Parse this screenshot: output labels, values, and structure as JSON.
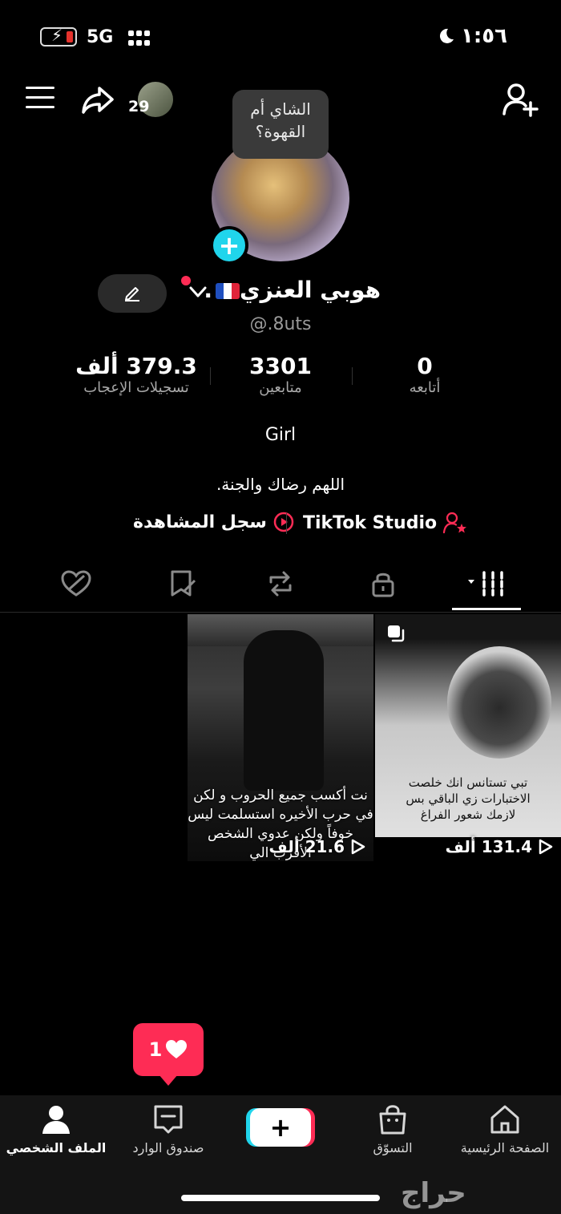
{
  "status": {
    "time": "١:٥٦",
    "network": "5G"
  },
  "header": {
    "friend_count": "29"
  },
  "profile": {
    "bubble_text": "الشاي أم القهوة؟",
    "display_name": "هوبي العنزي",
    "name_suffix": ".",
    "username": "@.8uts",
    "bio_line_1": "Girl",
    "bio_line_2": "اللهم رضاك والجنة.",
    "links": {
      "history": "سجل المشاهدة",
      "studio": "TikTok Studio"
    }
  },
  "stats": [
    {
      "value": "379.3 ألف",
      "label": "تسجيلات الإعجاب"
    },
    {
      "value": "3301",
      "label": "متابعين"
    },
    {
      "value": "0",
      "label": "أتابعه"
    }
  ],
  "videos": [
    {
      "caption": "نت أكسب جميع الحروب و لكن في حرب الأخيره استسلمت ليس خوفاً ولكن عدوي الشخص الأقرب الي",
      "views": "21.6 ألف"
    },
    {
      "caption": "تبي تستانس انك خلصت الاختبارات زي الباقي بس لازمك شعور الفراغ",
      "views": "131.4 ألف"
    }
  ],
  "notification": {
    "count": "1"
  },
  "bottom_nav": [
    {
      "label": "الملف الشخصي",
      "icon": "person-icon",
      "active": true
    },
    {
      "label": "صندوق الوارد",
      "icon": "inbox-icon"
    },
    {
      "label": "",
      "icon": "plus-icon"
    },
    {
      "label": "التسوّق",
      "icon": "shopping-bag-icon"
    },
    {
      "label": "الصفحة الرئيسية",
      "icon": "home-icon"
    }
  ],
  "watermark": "حراج",
  "colors": {
    "accent_red": "#fe2c55",
    "accent_cyan": "#20d5ec"
  }
}
